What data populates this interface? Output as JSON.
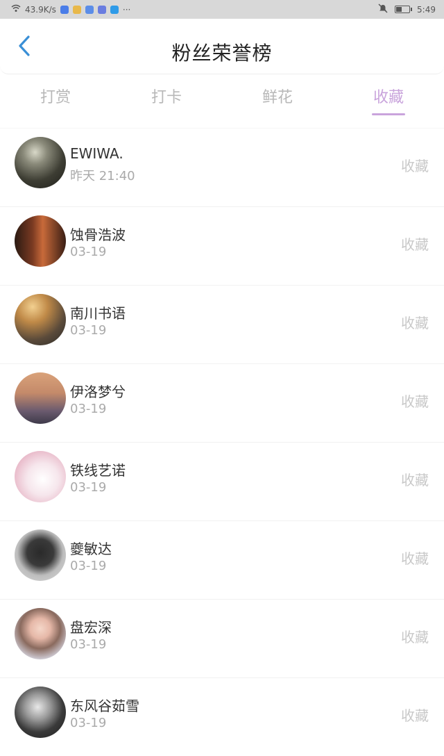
{
  "status_bar": {
    "speed": "43.9K/s",
    "dots": "···",
    "time": "5:49"
  },
  "header": {
    "title": "粉丝荣誉榜"
  },
  "tabs": [
    {
      "label": "打赏"
    },
    {
      "label": "打卡"
    },
    {
      "label": "鲜花"
    },
    {
      "label": "收藏"
    }
  ],
  "active_tab_index": 3,
  "colors": {
    "accent": "#c9a4dc",
    "back_arrow": "#3a8fd6"
  },
  "fans": [
    {
      "name": "EWIWA.",
      "date": "昨天 21:40",
      "action": "收藏"
    },
    {
      "name": "蚀骨浩波",
      "date": "03-19",
      "action": "收藏"
    },
    {
      "name": "南川书语",
      "date": "03-19",
      "action": "收藏"
    },
    {
      "name": "伊洛梦兮",
      "date": "03-19",
      "action": "收藏"
    },
    {
      "name": "铁线艺诺",
      "date": "03-19",
      "action": "收藏"
    },
    {
      "name": "夔敏达",
      "date": "03-19",
      "action": "收藏"
    },
    {
      "name": "盘宏深",
      "date": "03-19",
      "action": "收藏"
    },
    {
      "name": "东风谷茹雪",
      "date": "03-19",
      "action": "收藏"
    }
  ]
}
